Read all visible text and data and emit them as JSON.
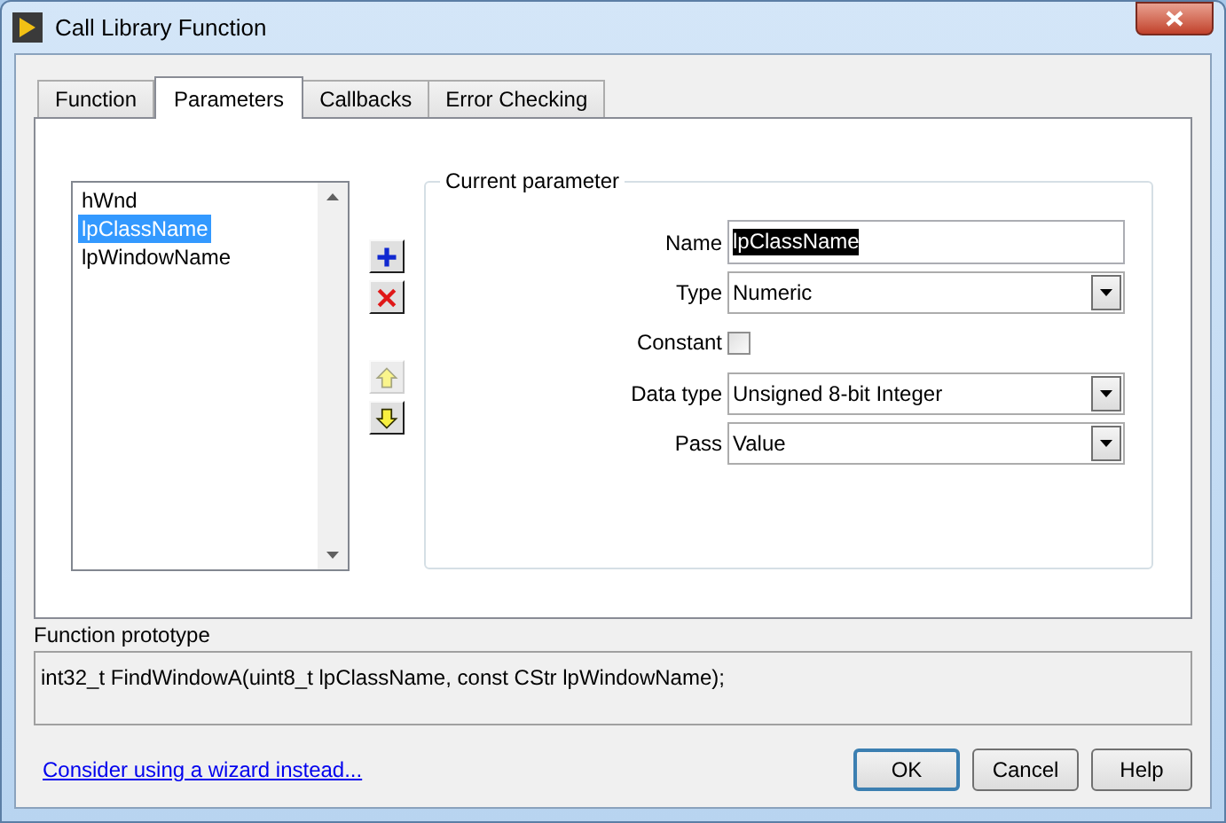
{
  "window": {
    "title": "Call Library Function"
  },
  "tabs": [
    {
      "label": "Function",
      "selected": false
    },
    {
      "label": "Parameters",
      "selected": true
    },
    {
      "label": "Callbacks",
      "selected": false
    },
    {
      "label": "Error Checking",
      "selected": false
    }
  ],
  "parameter_list": [
    {
      "label": "hWnd",
      "selected": false
    },
    {
      "label": "lpClassName",
      "selected": true
    },
    {
      "label": "lpWindowName",
      "selected": false
    }
  ],
  "list_tools": [
    {
      "kind": "add",
      "disabled": false
    },
    {
      "kind": "delete",
      "disabled": false
    },
    {
      "kind": "up",
      "disabled": true
    },
    {
      "kind": "down",
      "disabled": false
    }
  ],
  "current_parameter": {
    "title": "Current parameter",
    "rows": [
      {
        "kind": "text",
        "label": "Name",
        "value": "lpClassName",
        "text_selected": true
      },
      {
        "kind": "dropdown",
        "label": "Type",
        "value": "Numeric"
      },
      {
        "kind": "checkbox",
        "label": "Constant",
        "checked": false
      },
      {
        "kind": "dropdown",
        "label": "Data type",
        "value": "Unsigned 8-bit Integer"
      },
      {
        "kind": "dropdown",
        "label": "Pass",
        "value": "Value"
      }
    ]
  },
  "prototype": {
    "label": "Function prototype",
    "text": "int32_t FindWindowA(uint8_t lpClassName, const CStr lpWindowName);"
  },
  "wizard_link": "Consider using a wizard instead...",
  "buttons": [
    {
      "label": "OK",
      "default": true
    },
    {
      "label": "Cancel",
      "default": false
    },
    {
      "label": "Help",
      "default": false
    }
  ]
}
